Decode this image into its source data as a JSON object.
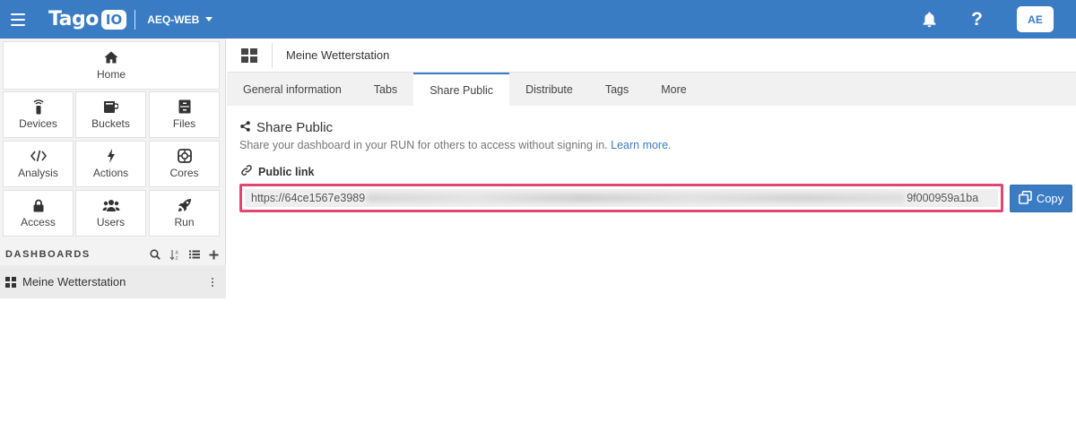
{
  "topbar": {
    "logo_text": "Tago",
    "logo_box": "IO",
    "account": "AEQ-WEB",
    "help_glyph": "?",
    "avatar": "AE",
    "color": "#3a7cc4"
  },
  "sidebar": {
    "home": "Home",
    "tiles": [
      {
        "label": "Devices",
        "icon": "devices-icon"
      },
      {
        "label": "Buckets",
        "icon": "buckets-icon"
      },
      {
        "label": "Files",
        "icon": "files-icon"
      },
      {
        "label": "Analysis",
        "icon": "analysis-icon"
      },
      {
        "label": "Actions",
        "icon": "actions-icon"
      },
      {
        "label": "Cores",
        "icon": "cores-icon"
      },
      {
        "label": "Access",
        "icon": "access-icon"
      },
      {
        "label": "Users",
        "icon": "users-icon"
      },
      {
        "label": "Run",
        "icon": "run-icon"
      }
    ],
    "dashboards_title": "DASHBOARDS",
    "dashboards": [
      {
        "label": "Meine Wetterstation"
      }
    ]
  },
  "main": {
    "breadcrumb_title": "Meine Wetterstation",
    "tabs": [
      {
        "label": "General information"
      },
      {
        "label": "Tabs"
      },
      {
        "label": "Share Public",
        "active": true
      },
      {
        "label": "Distribute"
      },
      {
        "label": "Tags"
      },
      {
        "label": "More"
      }
    ],
    "section_title": "Share Public",
    "section_desc": "Share your dashboard in your RUN for others to access without signing in.",
    "learn_more": "Learn more.",
    "public_link_label": "Public link",
    "url_start": "https://64ce1567e3989",
    "url_end": "9f000959a1ba",
    "copy_label": "Copy",
    "highlight_color": "#e0466f"
  }
}
